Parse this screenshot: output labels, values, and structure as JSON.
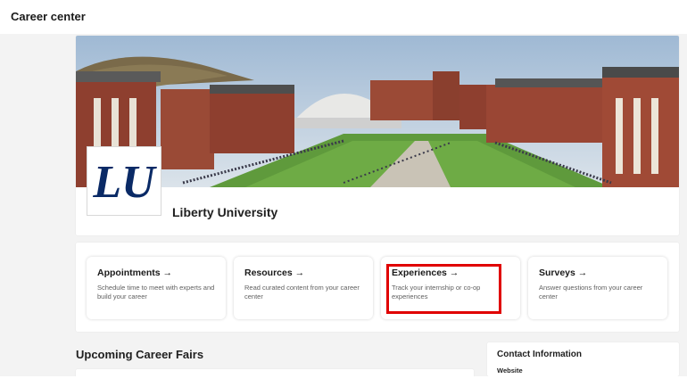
{
  "header": {
    "title": "Career center"
  },
  "hero": {
    "university_name": "Liberty University",
    "logo_text": "LU"
  },
  "quick_links": [
    {
      "title": "Appointments →",
      "description": "Schedule time to meet with experts and build your career"
    },
    {
      "title": "Resources →",
      "description": "Read curated content from your career center"
    },
    {
      "title": "Experiences →",
      "description": "Track your internship or co-op experiences"
    },
    {
      "title": "Surveys →",
      "description": "Answer questions from your career center"
    }
  ],
  "fairs": {
    "heading": "Upcoming Career Fairs"
  },
  "contact": {
    "title": "Contact Information",
    "website_label": "Website"
  },
  "colors": {
    "highlight": "#e00000",
    "logo_blue": "#0a2a66",
    "brick": "#8e3f2f"
  }
}
